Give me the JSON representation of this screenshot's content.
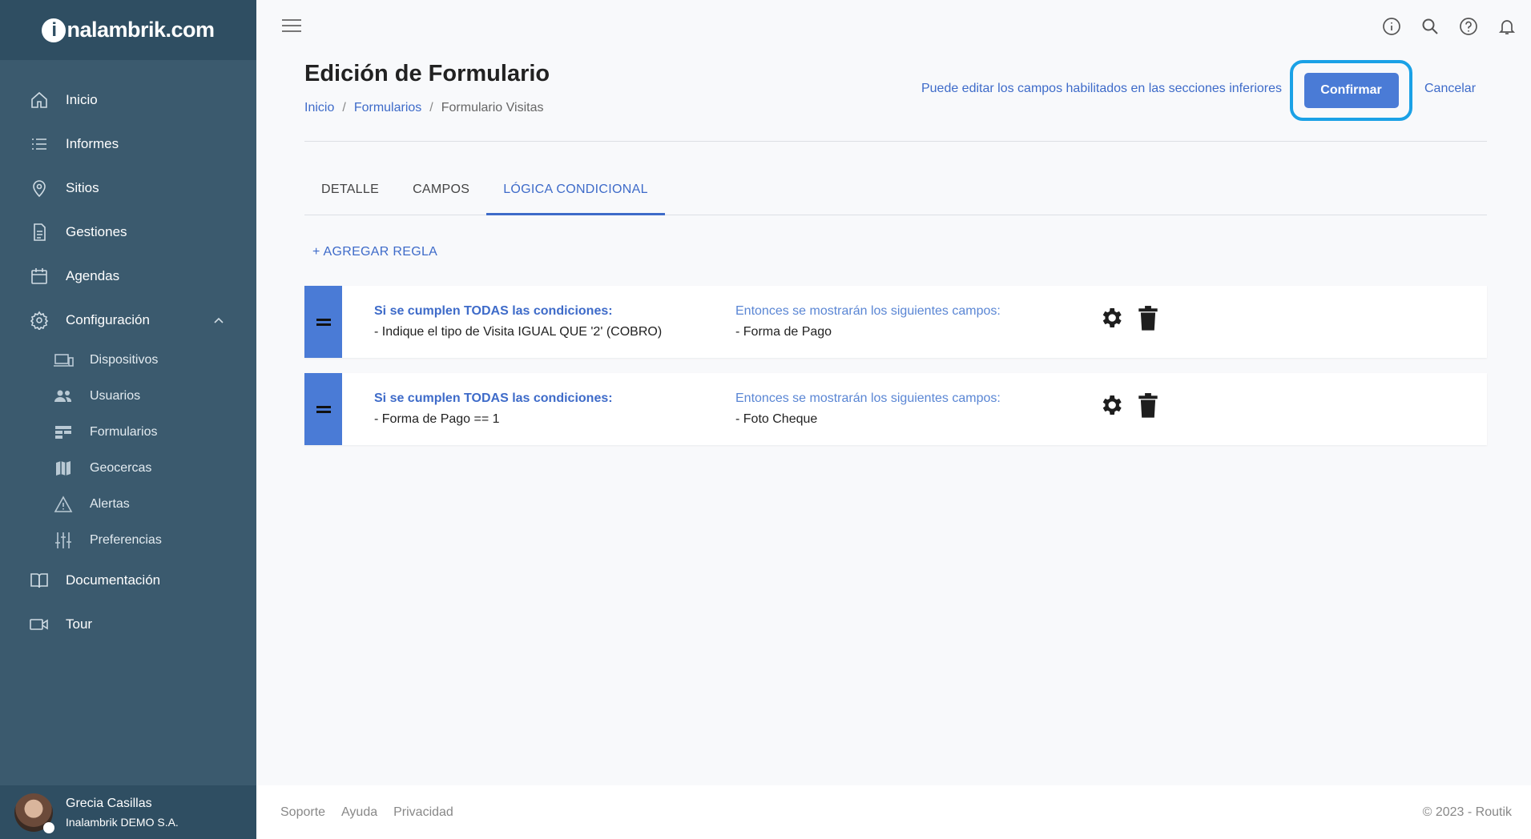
{
  "brand": {
    "logo_letter": "i",
    "logo_rest": "nalambrik.com"
  },
  "sidebar": {
    "items": [
      {
        "label": "Inicio",
        "icon": "home-icon"
      },
      {
        "label": "Informes",
        "icon": "list-icon"
      },
      {
        "label": "Sitios",
        "icon": "map-pin-icon"
      },
      {
        "label": "Gestiones",
        "icon": "document-icon"
      },
      {
        "label": "Agendas",
        "icon": "calendar-icon"
      },
      {
        "label": "Configuración",
        "icon": "gear-icon"
      }
    ],
    "sub_items": [
      {
        "label": "Dispositivos",
        "icon": "devices-icon"
      },
      {
        "label": "Usuarios",
        "icon": "users-icon"
      },
      {
        "label": "Formularios",
        "icon": "form-icon"
      },
      {
        "label": "Geocercas",
        "icon": "map-icon"
      },
      {
        "label": "Alertas",
        "icon": "warning-icon"
      },
      {
        "label": "Preferencias",
        "icon": "sliders-icon"
      }
    ],
    "bottom_items": [
      {
        "label": "Documentación",
        "icon": "book-icon"
      },
      {
        "label": "Tour",
        "icon": "video-icon"
      }
    ],
    "user": {
      "name": "Grecia Casillas",
      "org": "Inalambrik DEMO S.A."
    }
  },
  "header": {
    "title": "Edición de Formulario",
    "breadcrumb": [
      "Inicio",
      "Formularios",
      "Formulario Visitas"
    ],
    "breadcrumb_sep": "/",
    "hint": "Puede editar los campos habilitados en las secciones inferiores",
    "confirm_label": "Confirmar",
    "cancel_label": "Cancelar"
  },
  "tabs": [
    {
      "label": "DETALLE",
      "active": false
    },
    {
      "label": "CAMPOS",
      "active": false
    },
    {
      "label": "LÓGICA CONDICIONAL",
      "active": true
    }
  ],
  "add_rule_label": "+ AGREGAR REGLA",
  "rules": [
    {
      "condition_header": "Si se cumplen TODAS las condiciones:",
      "condition": "- Indique el tipo de Visita IGUAL QUE '2' (COBRO)",
      "result_header": "Entonces se mostrarán los siguientes campos:",
      "result": "- Forma de Pago"
    },
    {
      "condition_header": "Si se cumplen TODAS las condiciones:",
      "condition": "- Forma de Pago == 1",
      "result_header": "Entonces se mostrarán los siguientes campos:",
      "result": "- Foto Cheque"
    }
  ],
  "footer": {
    "links": [
      "Soporte",
      "Ayuda",
      "Privacidad"
    ],
    "copyright": "© 2023 - Routik"
  },
  "colors": {
    "sidebar_bg": "#3b5a6e",
    "sidebar_dark": "#2f4e62",
    "accent": "#3e6bc9",
    "button": "#4a7bd6",
    "highlight_ring": "#1aa1e6"
  }
}
